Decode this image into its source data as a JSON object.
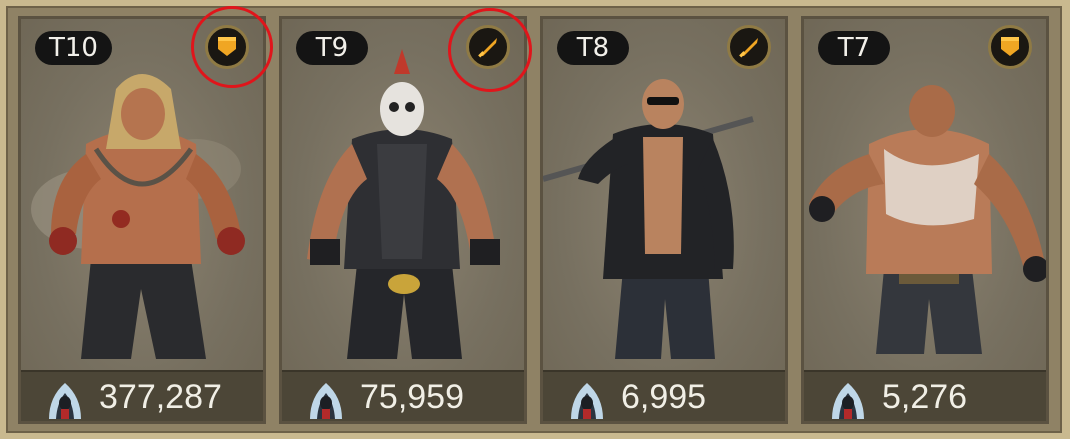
{
  "cards": [
    {
      "tier": "T10",
      "unit_type": "shield-icon",
      "count": "377,287",
      "highlighted": true
    },
    {
      "tier": "T9",
      "unit_type": "knife-icon",
      "count": "75,959",
      "highlighted": true
    },
    {
      "tier": "T8",
      "unit_type": "knife-icon",
      "count": "6,995",
      "highlighted": false
    },
    {
      "tier": "T7",
      "unit_type": "shield-icon",
      "count": "5,276",
      "highlighted": false
    }
  ],
  "colors": {
    "accent": "#f0a623",
    "highlight": "#e0151b",
    "panel": "#7a705c",
    "footer": "#4c4637"
  }
}
